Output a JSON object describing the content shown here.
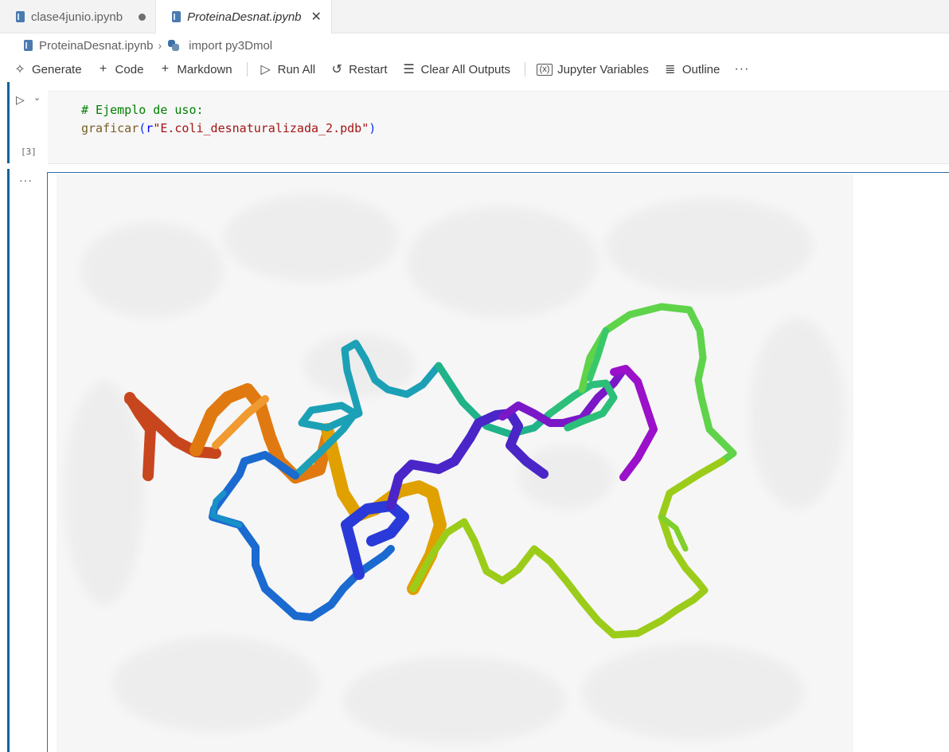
{
  "tabs": [
    {
      "label": "clase4junio.ipynb",
      "modified": true
    },
    {
      "label": "ProteinaDesnat.ipynb",
      "active": true
    }
  ],
  "breadcrumb": {
    "file": "ProteinaDesnat.ipynb",
    "symbol": "import py3Dmol"
  },
  "toolbar": {
    "generate": "Generate",
    "code": "Code",
    "markdown": "Markdown",
    "run_all": "Run All",
    "restart": "Restart",
    "clear_outputs": "Clear All Outputs",
    "variables": "Jupyter Variables",
    "outline": "Outline"
  },
  "cell": {
    "execution_count": "[3]",
    "comment": "# Ejemplo de uso:",
    "fn": "graficar",
    "open_paren": "(",
    "prefix": "r",
    "string": "\"E.coli_desnaturalizada_2.pdb\"",
    "close_paren": ")"
  },
  "viewer": {
    "background": "#f6f6f6",
    "ribbon_colors": [
      "#c8461e",
      "#e07a10",
      "#e0a000",
      "#1a9ebf",
      "#10a48a",
      "#2cbf7a",
      "#1a5fd9",
      "#3a2fd8",
      "#6a1fc8",
      "#9b10c9",
      "#a8c410",
      "#6ad42a",
      "#4ed65a"
    ]
  }
}
